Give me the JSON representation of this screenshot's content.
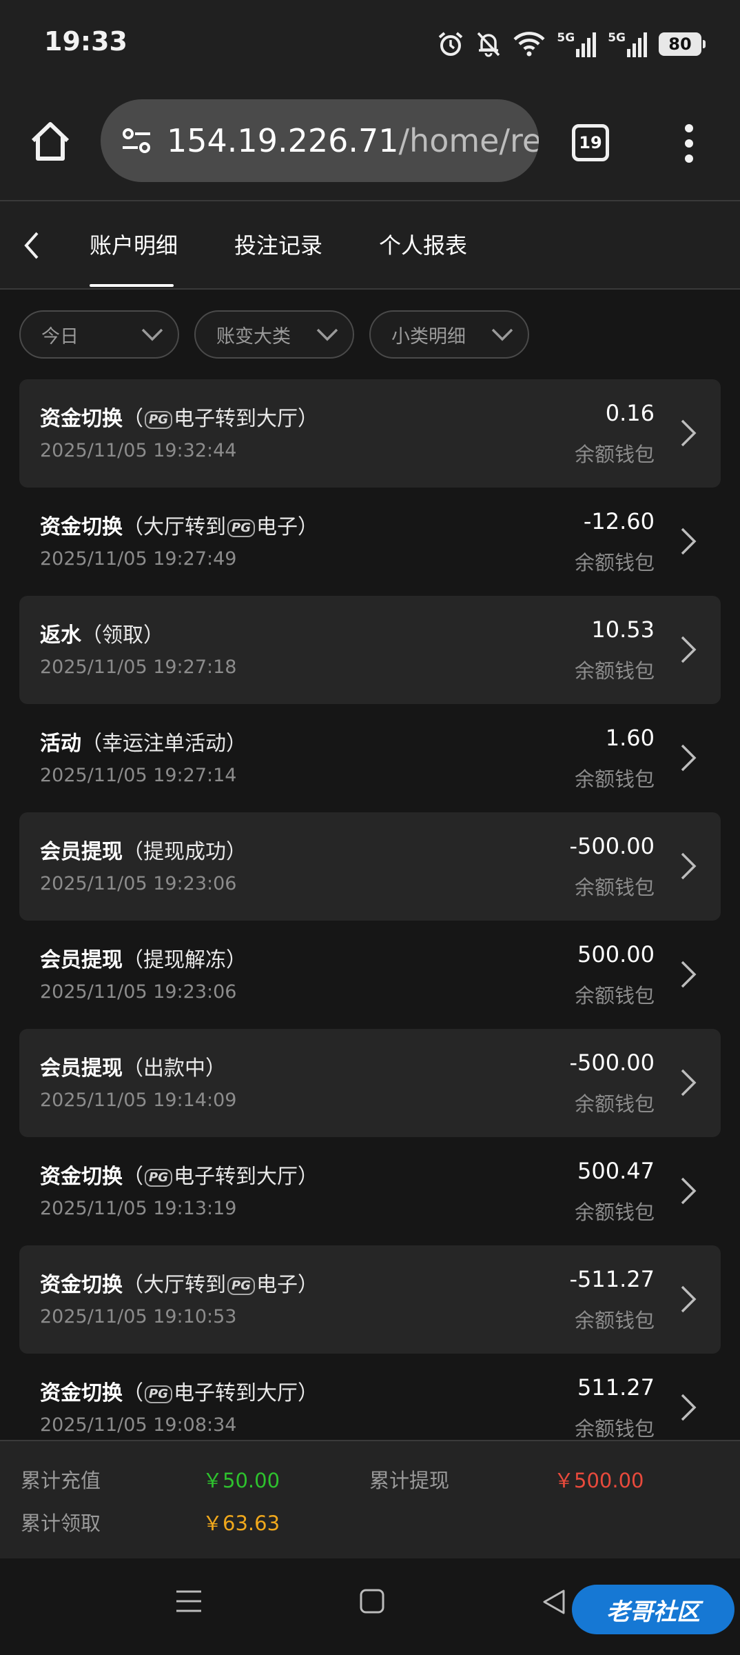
{
  "status_bar": {
    "time": "19:33",
    "battery": "80",
    "network_1": "5G",
    "network_2": "5G"
  },
  "browser": {
    "url_host": "154.19.226.71",
    "url_path": "/home/re",
    "tab_count": "19"
  },
  "tabs": [
    "账户明细",
    "投注记录",
    "个人报表"
  ],
  "active_tab": 0,
  "filters": [
    {
      "label": "今日"
    },
    {
      "label": "账变大类"
    },
    {
      "label": "小类明细"
    }
  ],
  "transactions": [
    {
      "type": "资金切换",
      "pre": "（",
      "badge": "PG",
      "post": "电子转到大厅）",
      "time": "2025/11/05 19:32:44",
      "amount": "0.16",
      "wallet": "余额钱包"
    },
    {
      "type": "资金切换",
      "pre": "（大厅转到",
      "badge": "PG",
      "post": "电子）",
      "time": "2025/11/05 19:27:49",
      "amount": "-12.60",
      "wallet": "余额钱包"
    },
    {
      "type": "返水",
      "pre": "（领取）",
      "badge": "",
      "post": "",
      "time": "2025/11/05 19:27:18",
      "amount": "10.53",
      "wallet": "余额钱包"
    },
    {
      "type": "活动",
      "pre": "（幸运注单活动）",
      "badge": "",
      "post": "",
      "time": "2025/11/05 19:27:14",
      "amount": "1.60",
      "wallet": "余额钱包"
    },
    {
      "type": "会员提现",
      "pre": "（提现成功）",
      "badge": "",
      "post": "",
      "time": "2025/11/05 19:23:06",
      "amount": "-500.00",
      "wallet": "余额钱包"
    },
    {
      "type": "会员提现",
      "pre": "（提现解冻）",
      "badge": "",
      "post": "",
      "time": "2025/11/05 19:23:06",
      "amount": "500.00",
      "wallet": "余额钱包"
    },
    {
      "type": "会员提现",
      "pre": "（出款中）",
      "badge": "",
      "post": "",
      "time": "2025/11/05 19:14:09",
      "amount": "-500.00",
      "wallet": "余额钱包"
    },
    {
      "type": "资金切换",
      "pre": "（",
      "badge": "PG",
      "post": "电子转到大厅）",
      "time": "2025/11/05 19:13:19",
      "amount": "500.47",
      "wallet": "余额钱包"
    },
    {
      "type": "资金切换",
      "pre": "（大厅转到",
      "badge": "PG",
      "post": "电子）",
      "time": "2025/11/05 19:10:53",
      "amount": "-511.27",
      "wallet": "余额钱包"
    },
    {
      "type": "资金切换",
      "pre": "（",
      "badge": "PG",
      "post": "电子转到大厅）",
      "time": "2025/11/05 19:08:34",
      "amount": "511.27",
      "wallet": "余额钱包"
    }
  ],
  "summary": {
    "recharge_label": "累计充值",
    "recharge_value": "￥50.00",
    "withdraw_label": "累计提现",
    "withdraw_value": "￥500.00",
    "claim_label": "累计领取",
    "claim_value": "￥63.63"
  },
  "colors": {
    "recharge": "#2ec12e",
    "withdraw": "#e84a3c",
    "claim": "#f0a81c"
  },
  "watermark": "老哥社区"
}
